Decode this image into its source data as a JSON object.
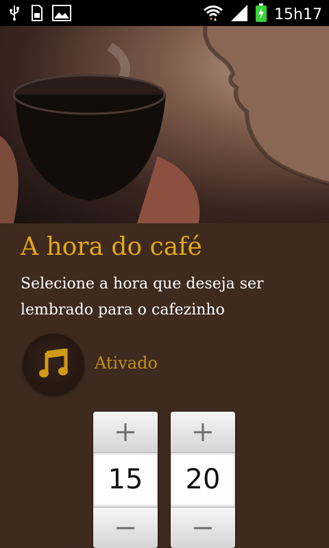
{
  "status_bar": {
    "time": "15h17",
    "icons": [
      "usb-icon",
      "sd-card-icon",
      "image-icon",
      "wifi-icon",
      "signal-icon",
      "battery-charging-icon"
    ],
    "battery_color": "#3bd13b"
  },
  "header": {
    "title": "A hora do café",
    "subtitle": "Selecione a hora que deseja ser lembrado para o cafezinho"
  },
  "alarm": {
    "status_label": "Ativado",
    "icon": "music-note-icon"
  },
  "time_picker": {
    "hour": "15",
    "minute": "20"
  },
  "colors": {
    "background": "#3e2a1f",
    "accent": "#e5a813",
    "status_text": "#c49215"
  }
}
